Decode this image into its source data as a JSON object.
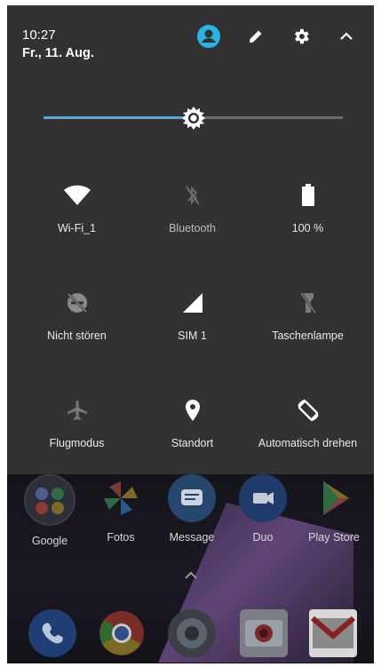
{
  "status": {
    "time": "10:27",
    "date": "Fr., 11. Aug."
  },
  "header_icons": [
    "user-account-icon",
    "edit-icon",
    "settings-gear-icon",
    "collapse-chevron-icon"
  ],
  "brightness": {
    "level": 0.5,
    "accent": "#5aa7d8"
  },
  "tiles": [
    {
      "label": "Wi-Fi_1",
      "icon": "wifi-icon",
      "active": true
    },
    {
      "label": "Bluetooth",
      "icon": "bluetooth-off-icon",
      "active": false
    },
    {
      "label": "100 %",
      "icon": "battery-full-icon",
      "active": true
    },
    {
      "label": "Nicht stören",
      "icon": "do-not-disturb-icon",
      "active": false
    },
    {
      "label": "SIM 1",
      "icon": "cell-signal-icon",
      "active": true
    },
    {
      "label": "Taschenlampe",
      "icon": "flashlight-off-icon",
      "active": false
    },
    {
      "label": "Flugmodus",
      "icon": "airplane-icon",
      "active": false
    },
    {
      "label": "Standort",
      "icon": "location-pin-icon",
      "active": true
    },
    {
      "label": "Automatisch drehen",
      "icon": "auto-rotate-icon",
      "active": true
    }
  ],
  "home_apps": [
    {
      "label": "Google"
    },
    {
      "label": "Fotos"
    },
    {
      "label": "Message"
    },
    {
      "label": "Duo"
    },
    {
      "label": "Play Store"
    }
  ],
  "dock_icons": [
    "phone-icon",
    "chrome-icon",
    "camera-app-icon",
    "camera-icon",
    "gmail-icon"
  ]
}
